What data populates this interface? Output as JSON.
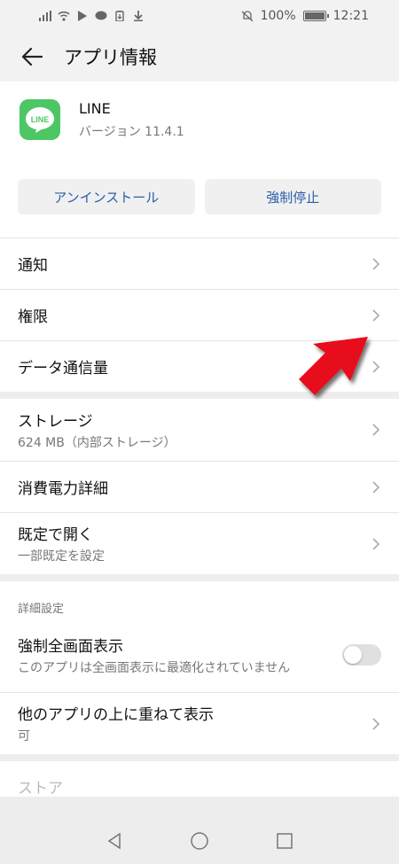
{
  "status_bar": {
    "battery_text": "100%",
    "time": "12:21"
  },
  "app_bar": {
    "title": "アプリ情報"
  },
  "app": {
    "name": "LINE",
    "version": "バージョン 11.4.1",
    "icon_color": "#4cc764",
    "icon_label": "LINE"
  },
  "buttons": {
    "uninstall": "アンインストール",
    "force_stop": "強制停止"
  },
  "section1": [
    {
      "label": "通知"
    },
    {
      "label": "権限"
    },
    {
      "label": "データ通信量"
    }
  ],
  "section2": [
    {
      "label": "ストレージ",
      "sub": "624 MB（内部ストレージ）"
    },
    {
      "label": "消費電力詳細"
    },
    {
      "label": "既定で開く",
      "sub": "一部既定を設定"
    }
  ],
  "advanced": {
    "caption": "詳細設定",
    "fullscreen_label": "強制全画面表示",
    "fullscreen_sub": "このアプリは全画面表示に最適化されていません",
    "fullscreen_enabled": false,
    "overlay_label": "他のアプリの上に重ねて表示",
    "overlay_sub": "可",
    "cut_label": "ストア"
  },
  "accent_colors": {
    "link_blue": "#2a5ea8",
    "arrow_red": "#e8101a"
  }
}
